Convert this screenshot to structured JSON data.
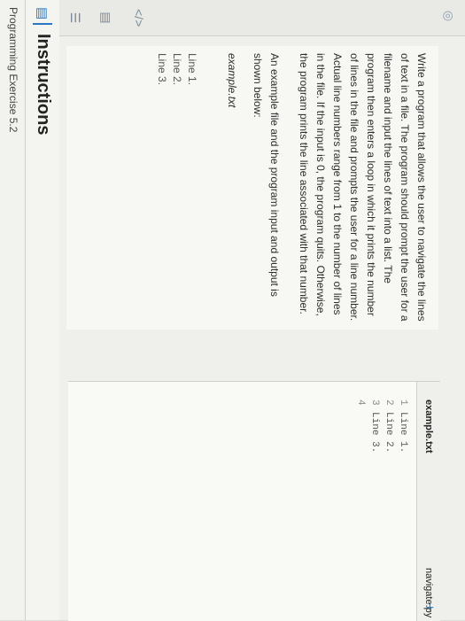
{
  "header": {
    "exercise_title": "Programming Exercise 5.2"
  },
  "instructions": {
    "title": "Instructions",
    "body": "Write a program that allows the user to navigate the lines of text in a file. The program should prompt the user for a filename and input the lines of text into a list. The program then enters a loop in which it prints the number of lines in the file and prompts the user for a line number. Actual line numbers range from 1 to the number of lines in the file. If the input is 0, the program quits. Otherwise, the program prints the line associated with that number.",
    "example_intro": "An example file and the program input and output is shown below:",
    "example_label": "example.txt",
    "example_lines": [
      "Line 1.",
      "Line 2.",
      "Line 3."
    ]
  },
  "editor": {
    "tabs": [
      {
        "label": "example.txt"
      },
      {
        "label": "navigate.py"
      }
    ],
    "add_tab_label": "+",
    "code_lines": [
      {
        "num": "1",
        "text": "Line 1."
      },
      {
        "num": "2",
        "text": "Line 2."
      },
      {
        "num": "3",
        "text": "Line 3."
      },
      {
        "num": "4",
        "text": ""
      }
    ]
  },
  "icons": {
    "book": "book-icon",
    "list": "list-icon",
    "chart": "chart-icon",
    "code": "code-icon",
    "target": "target-icon"
  }
}
